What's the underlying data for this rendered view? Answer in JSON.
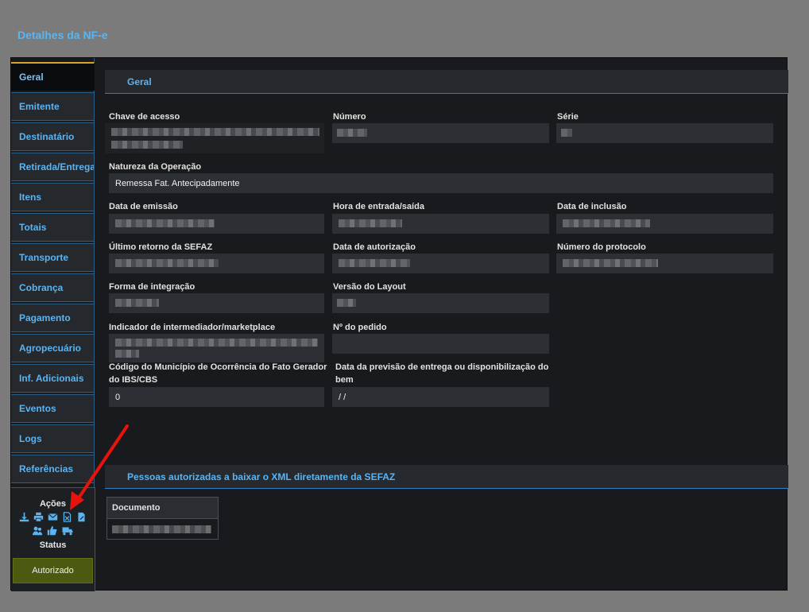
{
  "page_title": "Detalhes da NF-e",
  "sidebar": {
    "items": [
      {
        "label": "Geral",
        "active": true
      },
      {
        "label": "Emitente"
      },
      {
        "label": "Destinatário"
      },
      {
        "label": "Retirada/Entrega"
      },
      {
        "label": "Itens"
      },
      {
        "label": "Totais"
      },
      {
        "label": "Transporte"
      },
      {
        "label": "Cobrança"
      },
      {
        "label": "Pagamento"
      },
      {
        "label": "Agropecuário"
      },
      {
        "label": "Inf. Adicionais"
      },
      {
        "label": "Eventos"
      },
      {
        "label": "Logs"
      },
      {
        "label": "Referências"
      }
    ],
    "actions_label": "Ações",
    "action_icons": [
      "download-icon",
      "print-icon",
      "email-icon",
      "cancel-document-icon",
      "edit-document-icon",
      "users-icon",
      "thumbs-up-icon",
      "truck-icon"
    ],
    "status_label": "Status",
    "status_value": "Autorizado",
    "status_color": "#4a5a10"
  },
  "general": {
    "header": "Geral",
    "fields": {
      "chave_acesso": {
        "label": "Chave de acesso",
        "value": ""
      },
      "numero": {
        "label": "Número",
        "value": ""
      },
      "serie": {
        "label": "Série",
        "value": ""
      },
      "natureza": {
        "label": "Natureza da Operação",
        "value": "Remessa Fat. Antecipadamente"
      },
      "data_emissao": {
        "label": "Data de emissão",
        "value": ""
      },
      "hora_entrada": {
        "label": "Hora de entrada/saída",
        "value": ""
      },
      "data_inclusao": {
        "label": "Data de inclusão",
        "value": ""
      },
      "ultimo_retorno": {
        "label": "Último retorno da SEFAZ",
        "value": ""
      },
      "data_autorizacao": {
        "label": "Data de autorização",
        "value": ""
      },
      "numero_protocolo": {
        "label": "Número do protocolo",
        "value": ""
      },
      "forma_integracao": {
        "label": "Forma de integração",
        "value": ""
      },
      "versao_layout": {
        "label": "Versão do Layout",
        "value": ""
      },
      "indicador_intermediador": {
        "label": "Indicador de intermediador/marketplace",
        "value": ""
      },
      "numero_pedido": {
        "label": "Nº do pedido",
        "value": ""
      },
      "codigo_municipio": {
        "label": "Código do Município de Ocorrência do Fato Gerador do IBS/CBS",
        "value": "0"
      },
      "data_previsao": {
        "label": "Data da previsão de entrega ou disponibilização do bem",
        "value": "/ /"
      }
    }
  },
  "authorized": {
    "header": "Pessoas autorizadas a baixar o XML diretamente da SEFAZ",
    "columns": [
      "Documento"
    ],
    "rows": [
      [
        ""
      ]
    ]
  },
  "accent_color": "#5bb4f2",
  "annotation_arrow_color": "#e8140c"
}
